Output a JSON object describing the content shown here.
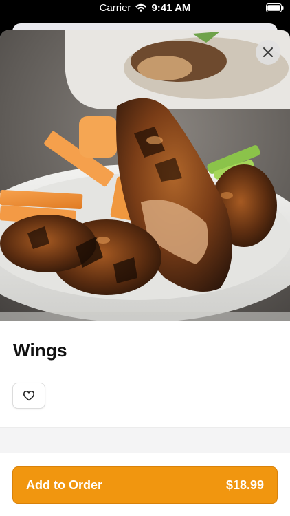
{
  "status_bar": {
    "carrier": "Carrier",
    "time": "9:41 AM"
  },
  "item": {
    "name": "Wings",
    "image_icon": "food-photo-wings"
  },
  "actions": {
    "close_icon": "close-icon",
    "favorite_icon": "heart-icon",
    "add_to_order_label": "Add to Order",
    "price": "$18.99"
  },
  "colors": {
    "accent": "#f1960f",
    "accent_border": "#d9820a"
  }
}
